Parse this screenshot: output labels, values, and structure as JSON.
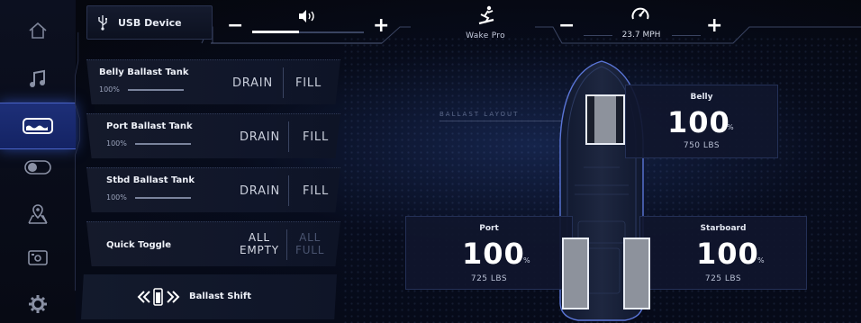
{
  "topbar": {
    "source_label": "USB Device",
    "volume": {
      "minus": "−",
      "plus": "+",
      "level": 0.42
    },
    "mode_label": "Wake Pro",
    "speed": {
      "minus": "−",
      "plus": "+",
      "value": "23.7 MPH"
    }
  },
  "rail": {
    "items": [
      {
        "icon": "home-icon",
        "active": false
      },
      {
        "icon": "music-icon",
        "active": false
      },
      {
        "icon": "ballast-icon",
        "active": true
      },
      {
        "icon": "toggle-icon",
        "active": false
      },
      {
        "icon": "map-icon",
        "active": false
      },
      {
        "icon": "camera-icon",
        "active": false
      },
      {
        "icon": "gear-icon",
        "active": false
      }
    ]
  },
  "tanks": [
    {
      "name": "Belly Ballast Tank",
      "percent": "100%",
      "drain": "DRAIN",
      "fill": "FILL",
      "level": 1.0
    },
    {
      "name": "Port Ballast Tank",
      "percent": "100%",
      "drain": "DRAIN",
      "fill": "FILL",
      "level": 1.0
    },
    {
      "name": "Stbd Ballast Tank",
      "percent": "100%",
      "drain": "DRAIN",
      "fill": "FILL",
      "level": 1.0
    }
  ],
  "quick_toggle": {
    "label": "Quick Toggle",
    "all_empty_1": "ALL",
    "all_empty_2": "EMPTY",
    "all_full_1": "ALL",
    "all_full_2": "FULL"
  },
  "ballast_shift": {
    "label": "Ballast Shift"
  },
  "layout_label": "BALLAST LAYOUT",
  "readouts": {
    "belly": {
      "title": "Belly",
      "value": "100",
      "unit": "%",
      "weight": "750 LBS"
    },
    "port": {
      "title": "Port",
      "value": "100",
      "unit": "%",
      "weight": "725 LBS"
    },
    "starboard": {
      "title": "Starboard",
      "value": "100",
      "unit": "%",
      "weight": "725 LBS"
    }
  },
  "colors": {
    "accent": "#2f4fb8",
    "active_bg": "#1d2f78",
    "tank_fill": "#9a9ea6"
  }
}
